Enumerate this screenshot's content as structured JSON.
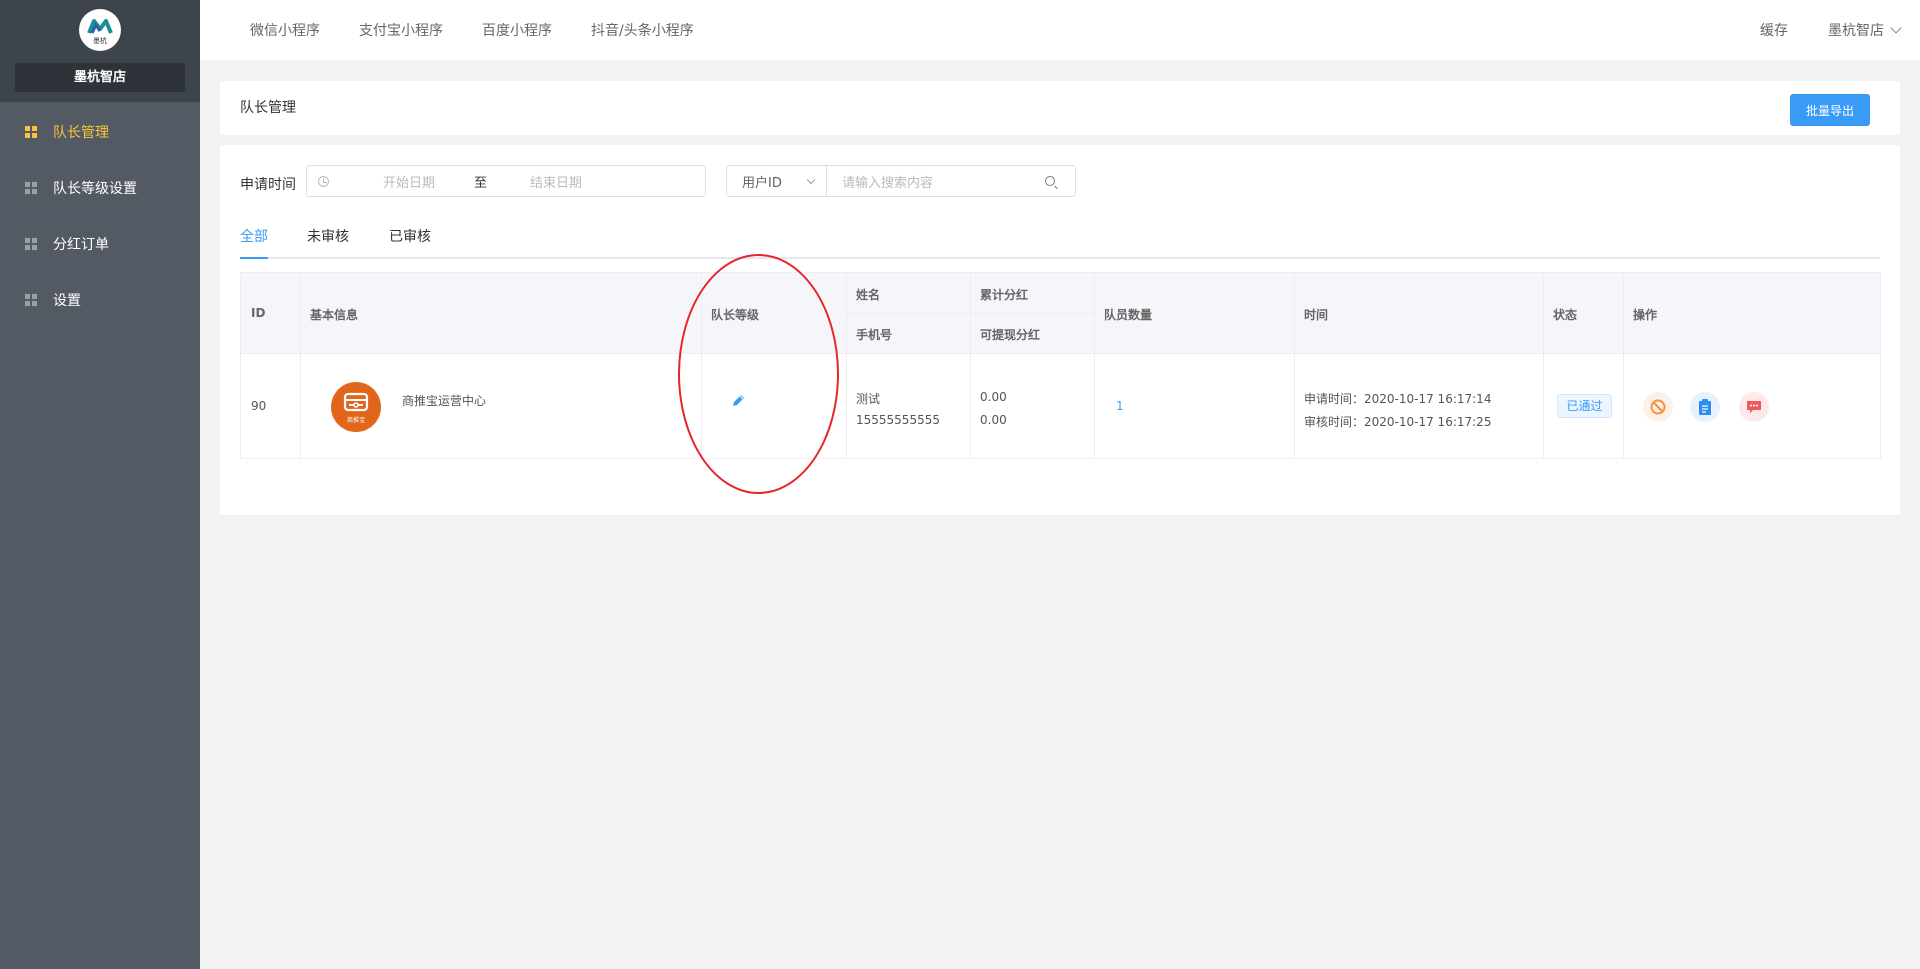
{
  "sidebar": {
    "store_name": "墨杭智店",
    "logo_text": "墨杭",
    "items": [
      {
        "label": "队长管理",
        "active": true
      },
      {
        "label": "队长等级设置",
        "active": false
      },
      {
        "label": "分红订单",
        "active": false
      },
      {
        "label": "设置",
        "active": false
      }
    ]
  },
  "topbar": {
    "nav": [
      "微信小程序",
      "支付宝小程序",
      "百度小程序",
      "抖音/头条小程序"
    ],
    "cache": "缓存",
    "user": "墨杭智店"
  },
  "page": {
    "title": "队长管理",
    "export_button": "批量导出"
  },
  "filter": {
    "label": "申请时间",
    "start_placeholder": "开始日期",
    "separator": "至",
    "end_placeholder": "结束日期",
    "search_field": "用户ID",
    "search_placeholder": "请输入搜索内容"
  },
  "tabs": [
    "全部",
    "未审核",
    "已审核"
  ],
  "table": {
    "headers": {
      "id": "ID",
      "basic_info": "基本信息",
      "leader_level": "队长等级",
      "name": "姓名",
      "phone": "手机号",
      "total_dividend": "累计分红",
      "withdrawable": "可提现分红",
      "member_count": "队员数量",
      "time": "时间",
      "status": "状态",
      "operation": "操作"
    },
    "rows": [
      {
        "id": "90",
        "shop_name": "商推宝运营中心",
        "avatar_caption": "商推宝",
        "name": "测试",
        "phone": "15555555555",
        "total_dividend": "0.00",
        "withdrawable": "0.00",
        "member_count": "1",
        "apply_time": "申请时间：2020-10-17 16:17:14",
        "review_time": "审核时间：2020-10-17 16:17:25",
        "status": "已通过"
      }
    ]
  },
  "colors": {
    "sidebar_bg": "#535a63",
    "active_menu": "#f8c53a",
    "primary": "#3a9bf6",
    "annotation": "#e8262a",
    "avatar_bg": "#e2651c"
  },
  "icons": [
    "grid-icon",
    "clock-icon",
    "search-icon",
    "chevron-down-icon",
    "edit-icon",
    "ban-icon",
    "clipboard-icon",
    "message-icon"
  ]
}
